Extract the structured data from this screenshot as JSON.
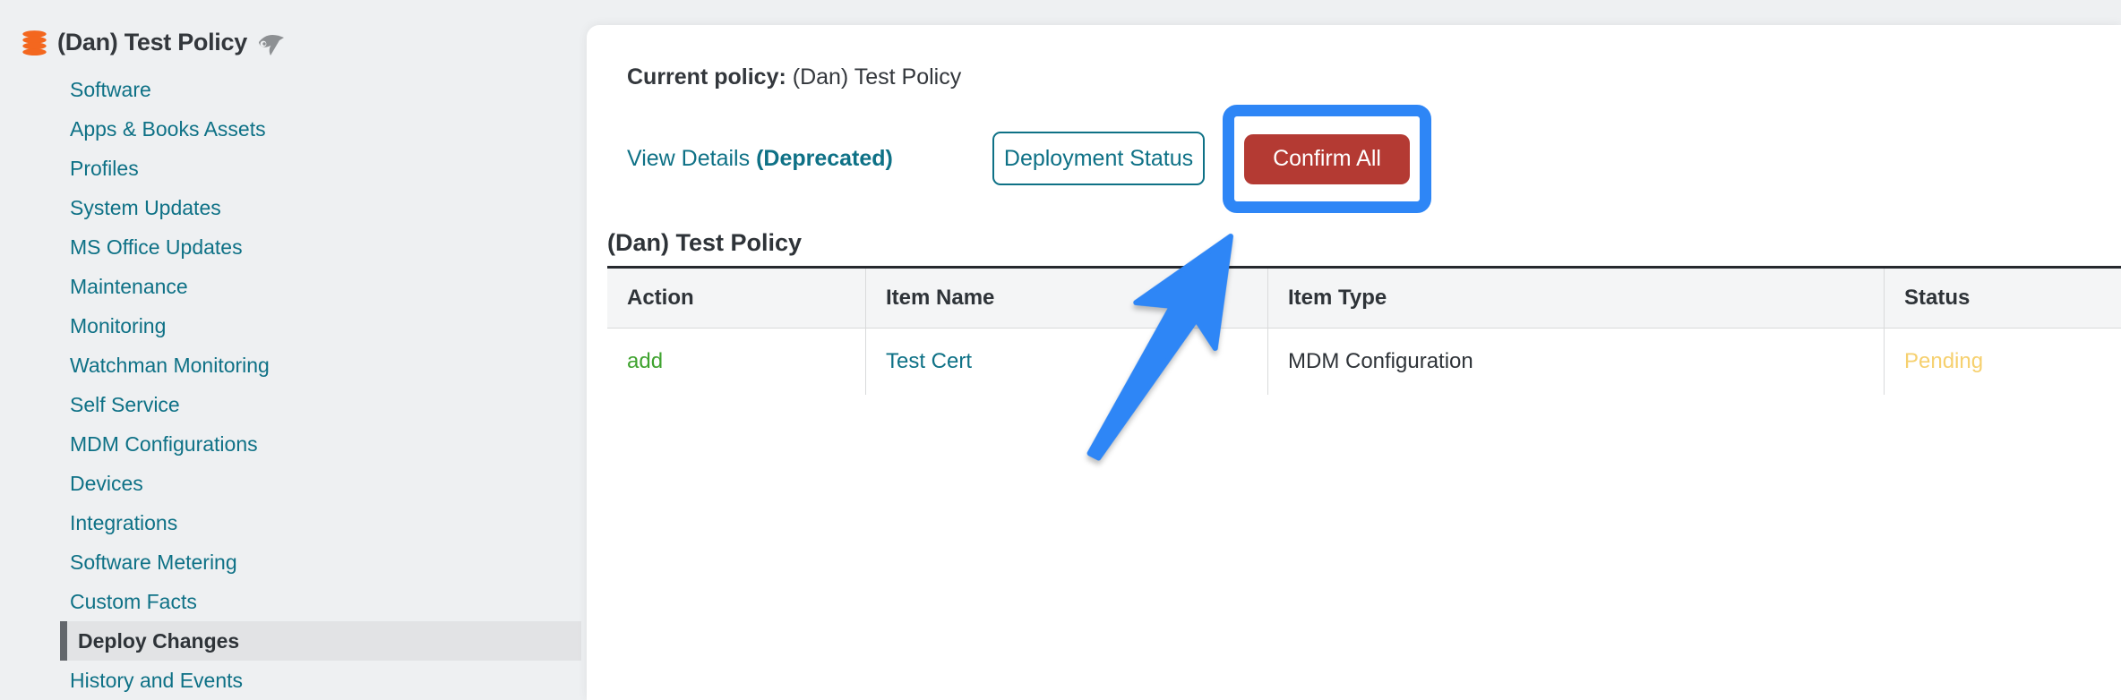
{
  "sidebar": {
    "title": "(Dan) Test Policy",
    "title_icons": [
      "database-icon",
      "kiosk-bird-icon"
    ],
    "items": [
      {
        "label": "Software",
        "selected": false
      },
      {
        "label": "Apps & Books Assets",
        "selected": false
      },
      {
        "label": "Profiles",
        "selected": false
      },
      {
        "label": "System Updates",
        "selected": false
      },
      {
        "label": "MS Office Updates",
        "selected": false
      },
      {
        "label": "Maintenance",
        "selected": false
      },
      {
        "label": "Monitoring",
        "selected": false
      },
      {
        "label": "Watchman Monitoring",
        "selected": false
      },
      {
        "label": "Self Service",
        "selected": false
      },
      {
        "label": "MDM Configurations",
        "selected": false
      },
      {
        "label": "Devices",
        "selected": false
      },
      {
        "label": "Integrations",
        "selected": false
      },
      {
        "label": "Software Metering",
        "selected": false
      },
      {
        "label": "Custom Facts",
        "selected": false
      },
      {
        "label": "Deploy Changes",
        "selected": true
      },
      {
        "label": "History and Events",
        "selected": false
      }
    ]
  },
  "main": {
    "current_policy": {
      "label": "Current policy:",
      "value": "(Dan) Test Policy"
    },
    "actions": {
      "view_details": {
        "text": "View Details",
        "suffix": "(Deprecated)"
      },
      "deployment_status": "Deployment Status",
      "confirm_all": "Confirm All"
    },
    "section_title": "(Dan) Test Policy",
    "table": {
      "columns": [
        "Action",
        "Item Name",
        "Item Type",
        "Status"
      ],
      "rows": [
        {
          "action": "add",
          "item_name": "Test Cert",
          "item_type": "MDM Configuration",
          "status": "Pending"
        }
      ]
    }
  },
  "annotations": {
    "highlight_box_target": "Confirm All",
    "arrow_target": "Confirm All"
  },
  "colors": {
    "accent_teal": "#0e7186",
    "button_red": "#b43a33",
    "highlight_blue": "#2e86f6",
    "action_add_green": "#3fa32f",
    "status_pending_yellow": "#f6d06e",
    "sidebar_bg": "#eef0f2",
    "selected_item_bg": "#e2e3e5",
    "table_header_bg": "#f4f5f6",
    "database_icon_orange": "#f3671f"
  }
}
